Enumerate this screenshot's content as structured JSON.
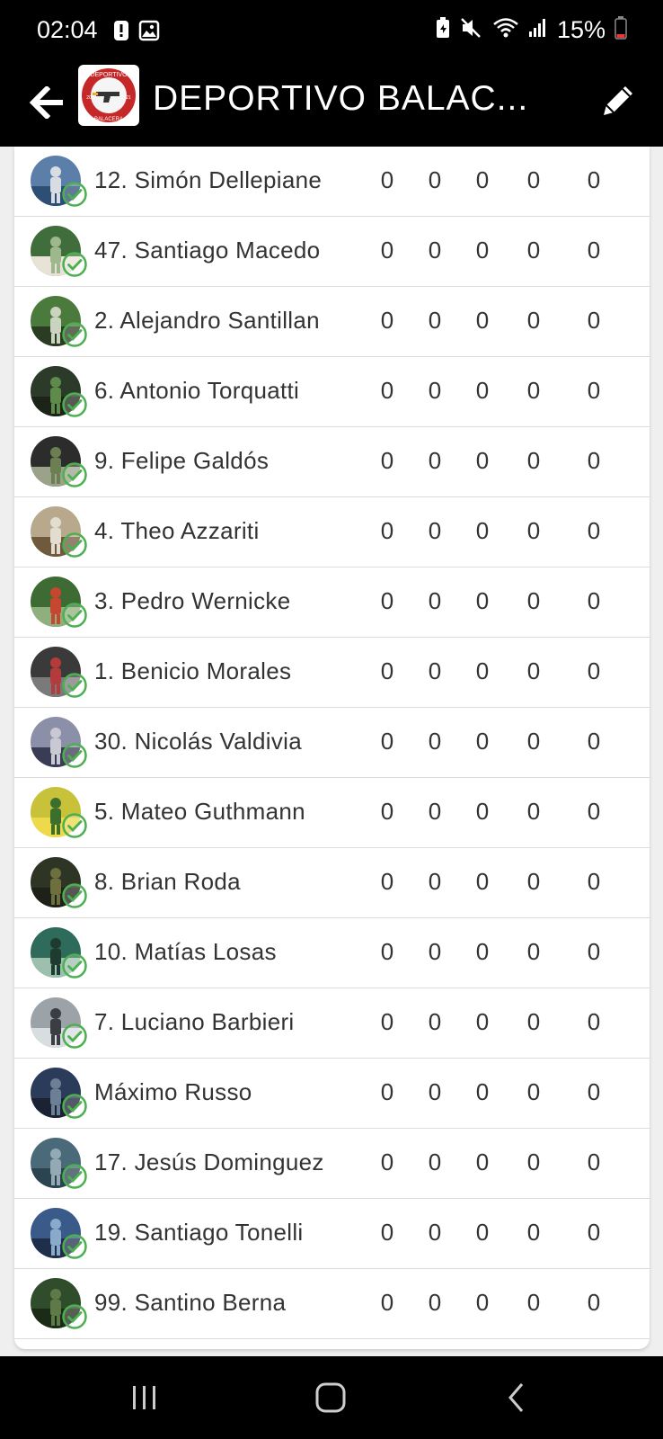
{
  "status_bar": {
    "time": "02:04",
    "battery": "15%",
    "icons": [
      "alert-icon",
      "image-icon",
      "battery-saver-icon",
      "mute-icon",
      "wifi-icon",
      "signal-icon",
      "battery-icon"
    ]
  },
  "app_bar": {
    "title": "DEPORTIVO BALAC...",
    "logo_text_top": "DEPORTIVO",
    "logo_text_bottom": "BALACERA",
    "logo_text_left": "20",
    "logo_text_right": "21"
  },
  "players": [
    {
      "name": "12. Simón Dellepiane",
      "stats": [
        "0",
        "0",
        "0",
        "0",
        "0"
      ]
    },
    {
      "name": "47. Santiago Macedo",
      "stats": [
        "0",
        "0",
        "0",
        "0",
        "0"
      ]
    },
    {
      "name": "2. Alejandro Santillan",
      "stats": [
        "0",
        "0",
        "0",
        "0",
        "0"
      ]
    },
    {
      "name": "6. Antonio Torquatti",
      "stats": [
        "0",
        "0",
        "0",
        "0",
        "0"
      ]
    },
    {
      "name": "9. Felipe Galdós",
      "stats": [
        "0",
        "0",
        "0",
        "0",
        "0"
      ]
    },
    {
      "name": "4. Theo Azzariti",
      "stats": [
        "0",
        "0",
        "0",
        "0",
        "0"
      ]
    },
    {
      "name": "3. Pedro Wernicke",
      "stats": [
        "0",
        "0",
        "0",
        "0",
        "0"
      ]
    },
    {
      "name": "1. Benicio Morales",
      "stats": [
        "0",
        "0",
        "0",
        "0",
        "0"
      ]
    },
    {
      "name": "30. Nicolás Valdivia",
      "stats": [
        "0",
        "0",
        "0",
        "0",
        "0"
      ]
    },
    {
      "name": "5. Mateo Guthmann",
      "stats": [
        "0",
        "0",
        "0",
        "0",
        "0"
      ]
    },
    {
      "name": "8. Brian Roda",
      "stats": [
        "0",
        "0",
        "0",
        "0",
        "0"
      ]
    },
    {
      "name": "10. Matías Losas",
      "stats": [
        "0",
        "0",
        "0",
        "0",
        "0"
      ]
    },
    {
      "name": "7. Luciano Barbieri",
      "stats": [
        "0",
        "0",
        "0",
        "0",
        "0"
      ]
    },
    {
      "name": "Máximo Russo",
      "stats": [
        "0",
        "0",
        "0",
        "0",
        "0"
      ]
    },
    {
      "name": "17. Jesús Dominguez",
      "stats": [
        "0",
        "0",
        "0",
        "0",
        "0"
      ]
    },
    {
      "name": "19. Santiago Tonelli",
      "stats": [
        "0",
        "0",
        "0",
        "0",
        "0"
      ]
    },
    {
      "name": "99. Santino Berna",
      "stats": [
        "0",
        "0",
        "0",
        "0",
        "0"
      ]
    }
  ],
  "colors": {
    "accent_green": "#4caf50",
    "logo_red": "#c62828",
    "bar_bg": "#000000"
  }
}
